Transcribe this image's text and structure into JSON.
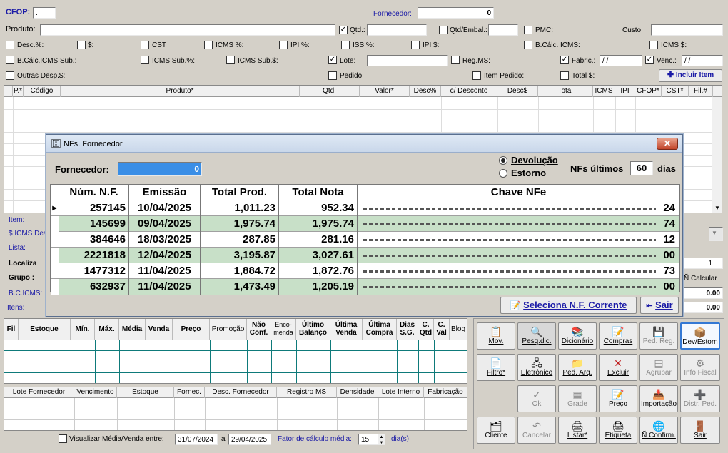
{
  "header": {
    "cfop_label": "CFOP:",
    "cfop_value": ".",
    "fornecedor_label": "Fornecedor:",
    "fornecedor_value": "0",
    "produto_label": "Produto:",
    "qtd_label": "Qtd.:",
    "qtd_embal_label": "Qtd/Embal.:",
    "pmc_label": "PMC:",
    "custo_label": "Custo:",
    "desc_pct": "Desc.%:",
    "cifrao": "$:",
    "cst": "CST",
    "icms_pct": "ICMS %:",
    "ipi_pct": "IPI %:",
    "iss_pct": "ISS %:",
    "ipi_cifrao": "IPI $:",
    "bcalc_icms": "B.Cálc. ICMS:",
    "icms_cifrao": "ICMS $:",
    "bcalc_icms_sub": "B.Cálc.ICMS Sub.:",
    "icms_sub_pct": "ICMS Sub.%:",
    "icms_sub_cifrao": "ICMS Sub.$:",
    "lote": "Lote:",
    "reg_ms": "Reg.MS:",
    "fabric": "Fabric.:",
    "fabric_value": " / /",
    "venc": "Venc.:",
    "venc_value": " / /",
    "outras_desp": "Outras Desp.$:",
    "pedido": "Pedido:",
    "item_pedido": "Item Pedido:",
    "total_cifrao": "Total $:",
    "incluir_item": "Incluir Item"
  },
  "items_grid": {
    "columns": [
      "P.*",
      "Código",
      "Produto*",
      "Qtd.",
      "Valor*",
      "Desc%",
      "c/ Desconto",
      "Desc$",
      "Total",
      "ICMS",
      "IPI",
      "CFOP*",
      "CST*",
      "Fil.#"
    ]
  },
  "side_labels": {
    "item": "Item:",
    "icms_desc": "$ ICMS Des",
    "lista": "Lista:",
    "localiza": "Localiza",
    "grupo": "Grupo :",
    "bc_icms": "B.C.ICMS:",
    "itens": "Itens:"
  },
  "right_mid": {
    "spin_value": "1",
    "n_calcular": "Ñ Calcular",
    "value1": "0.00",
    "value2": "0.00"
  },
  "modal": {
    "title": "NFs. Fornecedor",
    "close": "✕",
    "fornecedor_label": "Fornecedor:",
    "fornecedor_value": "0",
    "radio_devolucao": "Devolução",
    "radio_estorno": "Estorno",
    "nfs_ultimos_label": "NFs últimos",
    "nfs_ultimos_value": "60",
    "dias_label": "dias",
    "columns": [
      "Núm. N.F.",
      "Emissão",
      "Total Prod.",
      "Total Nota",
      "Chave NFe"
    ],
    "rows": [
      {
        "num": "257145",
        "emissao": "10/04/2025",
        "total_prod": "1,011.23",
        "total_nota": "952.34",
        "chave_end": "24"
      },
      {
        "num": "145699",
        "emissao": "09/04/2025",
        "total_prod": "1,975.74",
        "total_nota": "1,975.74",
        "chave_end": "74"
      },
      {
        "num": "384646",
        "emissao": "18/03/2025",
        "total_prod": "287.85",
        "total_nota": "281.16",
        "chave_end": "12"
      },
      {
        "num": "2221818",
        "emissao": "12/04/2025",
        "total_prod": "3,195.87",
        "total_nota": "3,027.61",
        "chave_end": "00"
      },
      {
        "num": "1477312",
        "emissao": "11/04/2025",
        "total_prod": "1,884.72",
        "total_nota": "1,872.76",
        "chave_end": "73"
      },
      {
        "num": "632937",
        "emissao": "11/04/2025",
        "total_prod": "1,473.49",
        "total_nota": "1,205.19",
        "chave_end": "00"
      }
    ],
    "btn_seleciona": "Seleciona N.F. Corrente",
    "btn_sair": "Sair"
  },
  "stock_grid": {
    "columns": [
      "Fil",
      "Estoque",
      "Mín.",
      "Máx.",
      "Média",
      "Venda",
      "Preço",
      "Promoção",
      "Não Conf.",
      "Enco- menda",
      "Último Balanço",
      "Última Venda",
      "Última Compra",
      "Dias S.G.",
      "C. Qtd",
      "C. Val",
      "Bloq"
    ]
  },
  "lote_grid": {
    "columns": [
      "Lote Fornecedor",
      "Vencimento",
      "Estoque",
      "Fornec.",
      "Desc. Fornecedor",
      "Registro MS",
      "Densidade",
      "Lote Interno",
      "Fabricação"
    ]
  },
  "footer": {
    "visualizar_label": "Visualizar Média/Venda entre:",
    "date_from": "31/07/2024",
    "a": "a",
    "date_to": "29/04/2025",
    "fator_label": "Fator de cálculo média:",
    "fator_value": "15",
    "dias": "dia(s)"
  },
  "buttons": [
    {
      "label": "Mov.",
      "icon": "📋",
      "disabled": false
    },
    {
      "label": "Pesq.dic.",
      "icon": "🔍",
      "disabled": false
    },
    {
      "label": "Dicionário",
      "icon": "📚",
      "disabled": false
    },
    {
      "label": "Compras",
      "icon": "📝",
      "disabled": false
    },
    {
      "label": "Ped. Reg.",
      "icon": "💾",
      "disabled": true
    },
    {
      "label": "Dev/Estorn",
      "icon": "📦",
      "disabled": false
    },
    {
      "label": "Filtro*",
      "icon": "📄",
      "disabled": false
    },
    {
      "label": "Eletrônico",
      "icon": "🖧",
      "disabled": false
    },
    {
      "label": "Ped. Arq.",
      "icon": "📁",
      "disabled": false
    },
    {
      "label": "Excluir",
      "icon": "✕",
      "disabled": false
    },
    {
      "label": "Agrupar",
      "icon": "▤",
      "disabled": true
    },
    {
      "label": "Info Fiscal",
      "icon": "⚙",
      "disabled": true
    },
    {
      "label": "Ok",
      "icon": "✓",
      "disabled": true
    },
    {
      "label": "Grade",
      "icon": "▦",
      "disabled": true
    },
    {
      "label": "Preço",
      "icon": "📝",
      "disabled": false
    },
    {
      "label": "Importação",
      "icon": "📥",
      "disabled": false
    },
    {
      "label": "Distr. Ped.",
      "icon": "➕",
      "disabled": true
    },
    {
      "label": "Cliente",
      "icon": "🗂",
      "disabled": false
    },
    {
      "label": "Cancelar",
      "icon": "↶",
      "disabled": true
    },
    {
      "label": "Listar*",
      "icon": "🖨",
      "disabled": false
    },
    {
      "label": "Etiqueta",
      "icon": "🖨",
      "disabled": false
    },
    {
      "label": "Ñ Confirm.",
      "icon": "🌐",
      "disabled": false
    },
    {
      "label": "Sair",
      "icon": "🚪",
      "disabled": false
    }
  ]
}
